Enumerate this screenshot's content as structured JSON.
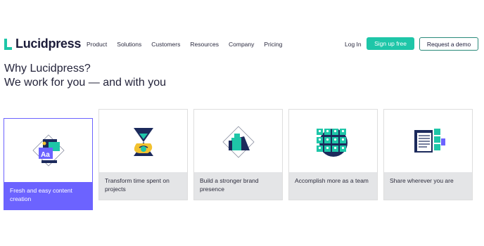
{
  "brand": {
    "name": "Lucidpress",
    "accent": "#1ec6a8",
    "purple": "#6c63ff"
  },
  "nav": {
    "items": [
      {
        "label": "Product"
      },
      {
        "label": "Solutions"
      },
      {
        "label": "Customers"
      },
      {
        "label": "Resources"
      },
      {
        "label": "Company"
      },
      {
        "label": "Pricing"
      }
    ],
    "login": "Log In",
    "signup": "Sign up free",
    "demo": "Request a demo"
  },
  "hero": {
    "line1": "Why Lucidpress?",
    "line2": "We work for you — and with you"
  },
  "cards": [
    {
      "caption": "Fresh and easy content creation",
      "icon": "content-creation-icon"
    },
    {
      "caption": "Transform time spent on projects",
      "icon": "hourglass-icon"
    },
    {
      "caption": "Build a stronger brand presence",
      "icon": "thumbs-up-icon"
    },
    {
      "caption": "Accomplish more as a team",
      "icon": "team-grid-icon"
    },
    {
      "caption": "Share wherever you are",
      "icon": "share-document-icon"
    }
  ]
}
